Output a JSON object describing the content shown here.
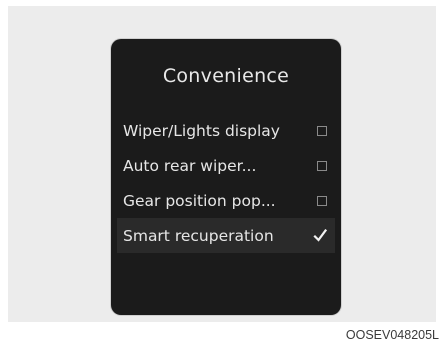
{
  "screen": {
    "title": "Convenience",
    "items": [
      {
        "label": "Wiper/Lights display",
        "checked": false
      },
      {
        "label": "Auto rear wiper...",
        "checked": false
      },
      {
        "label": "Gear position pop...",
        "checked": false
      },
      {
        "label": "Smart recuperation",
        "checked": true
      }
    ]
  },
  "figure_code": "OOSEV048205L"
}
